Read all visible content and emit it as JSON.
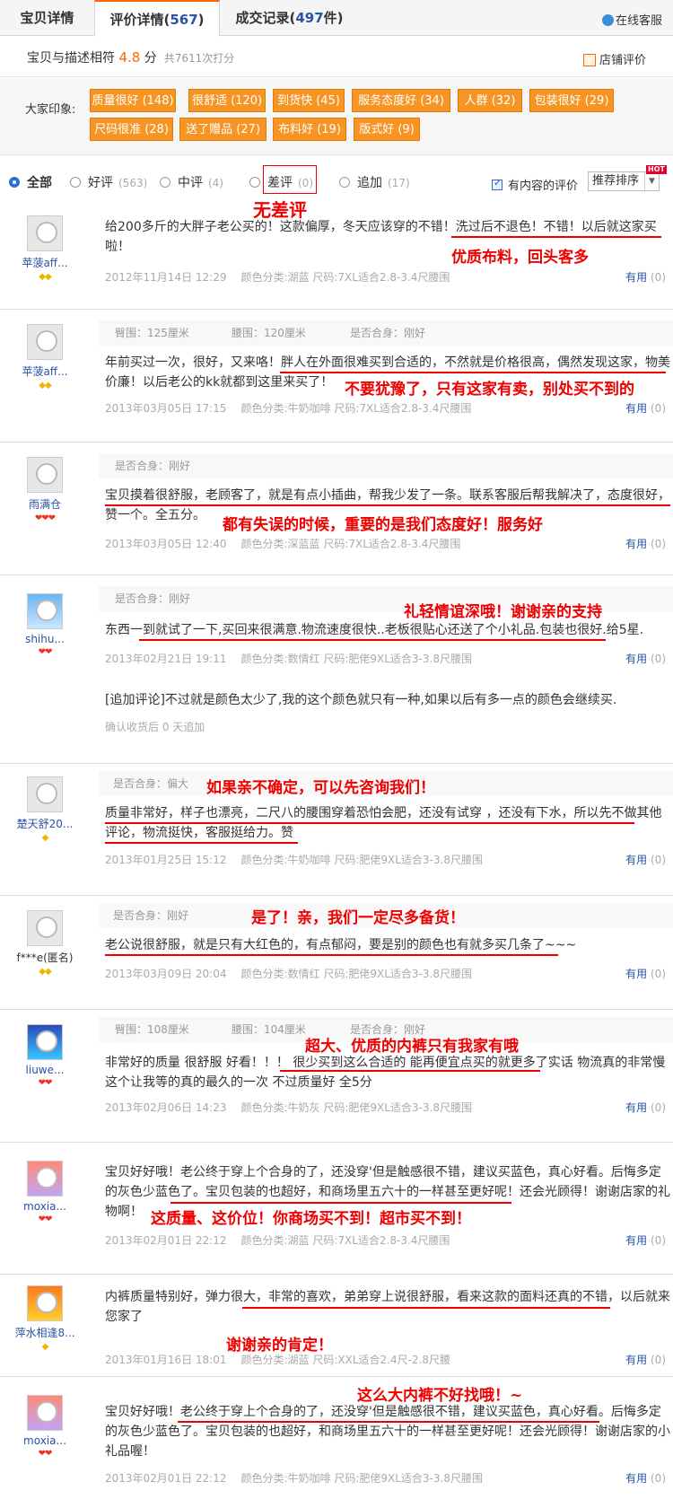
{
  "tabs": [
    {
      "label": "宝贝详情"
    },
    {
      "label": "评价详情",
      "count": "567"
    },
    {
      "label": "成交记录",
      "count": "497",
      "suffix": "件"
    }
  ],
  "customer_service": "在线客服",
  "rating": {
    "label": "宝贝与描述相符",
    "score": "4.8",
    "unit": "分",
    "count": "共7611次打分",
    "store": "店铺评价"
  },
  "impressions_label": "大家印象:",
  "tags": [
    "质量很好 (148)",
    "很舒适 (120)",
    "到货快 (45)",
    "服务态度好 (34)",
    "人群 (32)",
    "包装很好 (29)",
    "尺码很准 (28)",
    "送了赠品 (27)",
    "布料好 (19)",
    "版式好 (9)"
  ],
  "filters": [
    {
      "label": "全部",
      "count": ""
    },
    {
      "label": "好评",
      "count": "(563)"
    },
    {
      "label": "中评",
      "count": "(4)"
    },
    {
      "label": "差评",
      "count": "(0)"
    },
    {
      "label": "追加",
      "count": "(17)"
    }
  ],
  "content_check": "有内容的评价",
  "sort_label": "推荐排序",
  "hot": "HOT",
  "annotation_top": "无差评",
  "useful_label": "有用",
  "useful_count": "(0)",
  "reviews": [
    {
      "user": "苹菠aff...",
      "badge": "◆◆",
      "text": "给200多斤的大胖子老公买的！这款偏厚，冬天应该穿的不错！洗过后不退色！不错！以后就这家买啦！",
      "date": "2012年11月14日 12:29",
      "sku": "颜色分类:湖蓝  尺码:7XL适合2.8-3.4尺腰围",
      "note": "优质布料，回头客多"
    },
    {
      "user": "苹菠aff...",
      "badge": "◆◆",
      "p1": "臀围：125厘米",
      "p2": "腰围：120厘米",
      "p3": "是否合身：刚好",
      "text": "年前买过一次，很好，又来咯！胖人在外面很难买到合适的，不然就是价格很高，偶然发现这家，物美价廉！以后老公的kk就都到这里来买了！",
      "date": "2013年03月05日 17:15",
      "sku": "颜色分类:牛奶咖啡  尺码:7XL适合2.8-3.4尺腰围",
      "note": "不要犹豫了，只有这家有卖，别处买不到的"
    },
    {
      "user": "雨满仓",
      "badge": "❤❤❤",
      "p3": "是否合身：刚好",
      "text": "宝贝摸着很舒服，老顾客了，就是有点小插曲，帮我少发了一条。联系客服后帮我解决了，态度很好，赞一个。全五分。",
      "date": "2013年03月05日 12:40",
      "sku": "颜色分类:深蓝蓝  尺码:7XL适合2.8-3.4尺腰围",
      "note": "都有失误的时候，重要的是我们态度好！服务好"
    },
    {
      "user": "shihu...",
      "badge": "❤❤",
      "p3": "是否合身：刚好",
      "text": "东西一到就试了一下,买回来很满意.物流速度很快..老板很贴心还送了个小礼品.包装也很好.给5星.",
      "date": "2013年02月21日 19:11",
      "sku": "颜色分类:数情红  尺码:肥佬9XL适合3-3.8尺腰围",
      "note": "礼轻情谊深哦！谢谢亲的支持",
      "append": "[追加评论]不过就是颜色太少了,我的这个颜色就只有一种,如果以后有多一点的颜色会继续买.",
      "append_meta": "确认收货后 0 天追加"
    },
    {
      "user": "楚天舒20...",
      "badge": "◆",
      "p3": "是否合身：偏大",
      "text": "质量非常好，样子也漂亮，二尺八的腰围穿着恐怕会肥，还没有试穿 ，还没有下水，所以先不做其他评论，物流挺快，客服挺给力。赞",
      "date": "2013年01月25日 15:12",
      "sku": "颜色分类:牛奶咖啡  尺码:肥佬9XL适合3-3.8尺腰围",
      "note": "如果亲不确定，可以先咨询我们！"
    },
    {
      "user": "f***e(匿名)",
      "badge": "◆◆",
      "p3": "是否合身：刚好",
      "text": "老公说很舒服，就是只有大红色的，有点郁闷，要是别的颜色也有就多买几条了~~~",
      "date": "2013年03月09日 20:04",
      "sku": "颜色分类:数情红  尺码:肥佬9XL适合3-3.8尺腰围",
      "note": "是了！亲，我们一定尽多备货！"
    },
    {
      "user": "liuwe...",
      "badge": "❤❤",
      "p1": "臀围：108厘米",
      "p2": "腰围：104厘米",
      "p3": "是否合身：刚好",
      "text": "非常好的质量 很舒服 好看！！！ 很少买到这么合适的 能再便宜点买的就更多了实话 物流真的非常慢 这个让我等的真的最久的一次 不过质量好 全5分",
      "date": "2013年02月06日 14:23",
      "sku": "颜色分类:牛奶灰  尺码:肥佬9XL适合3-3.8尺腰围",
      "note": "超大、优质的内裤只有我家有哦"
    },
    {
      "user": "moxia...",
      "badge": "❤❤",
      "text": "宝贝好好哦！老公终于穿上个合身的了，还没穿'但是触感很不错，建议买蓝色，真心好看。后悔多定的灰色少蓝色了。宝贝包装的也超好，和商场里五六十的一样甚至更好呢！还会光顾得！谢谢店家的礼物啊！",
      "date": "2013年02月01日 22:12",
      "sku": "颜色分类:湖蓝  尺码:7XL适合2.8-3.4尺腰围",
      "note": "这质量、这价位！你商场买不到！超市买不到！"
    },
    {
      "user": "萍水相逢8...",
      "badge": "◆",
      "text": "内裤质量特别好，弹力很大，非常的喜欢，弟弟穿上说很舒服，看来这款的面料还真的不错，以后就来您家了",
      "date": "2013年01月16日 18:01",
      "sku": "颜色分类:湖蓝  尺码:XXL适合2.4尺-2.8尺腰",
      "note": "谢谢亲的肯定！"
    },
    {
      "user": "moxia...",
      "badge": "❤❤",
      "text": "宝贝好好哦！老公终于穿上个合身的了，还没穿'但是触感很不错，建议买蓝色，真心好看。后悔多定的灰色少蓝色了。宝贝包装的也超好，和商场里五六十的一样甚至更好呢！还会光顾得！谢谢店家的小礼品喔！",
      "date": "2013年02月01日 22:12",
      "sku": "颜色分类:牛奶咖啡  尺码:肥佬9XL适合3-3.8尺腰围",
      "note": "这么大内裤不好找哦！~"
    }
  ]
}
